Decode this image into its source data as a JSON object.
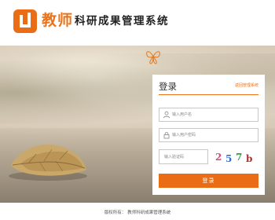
{
  "header": {
    "brand_main": "教师",
    "brand_sub": "科研成果管理系统"
  },
  "login": {
    "title": "登录",
    "sub_link": "返回管理系统",
    "username_placeholder": "输入用户名",
    "password_placeholder": "输入用户密码",
    "captcha_placeholder": "输入验证码",
    "captcha_chars": [
      "2",
      "5",
      "7",
      "b"
    ],
    "captcha_colors": [
      "#d64a7a",
      "#2f6fd0",
      "#2f9a47",
      "#a6332f"
    ],
    "login_button": "登录"
  },
  "footer": {
    "copyright_label": "版权所有：",
    "copyright_owner": "教师科研成果管理系统"
  },
  "colors": {
    "accent": "#ea6c14",
    "brand_text": "#e8731b"
  },
  "icons": {
    "logo": "brand-logo-icon",
    "user": "user-icon",
    "lock": "lock-icon",
    "butterfly": "butterfly-icon"
  }
}
